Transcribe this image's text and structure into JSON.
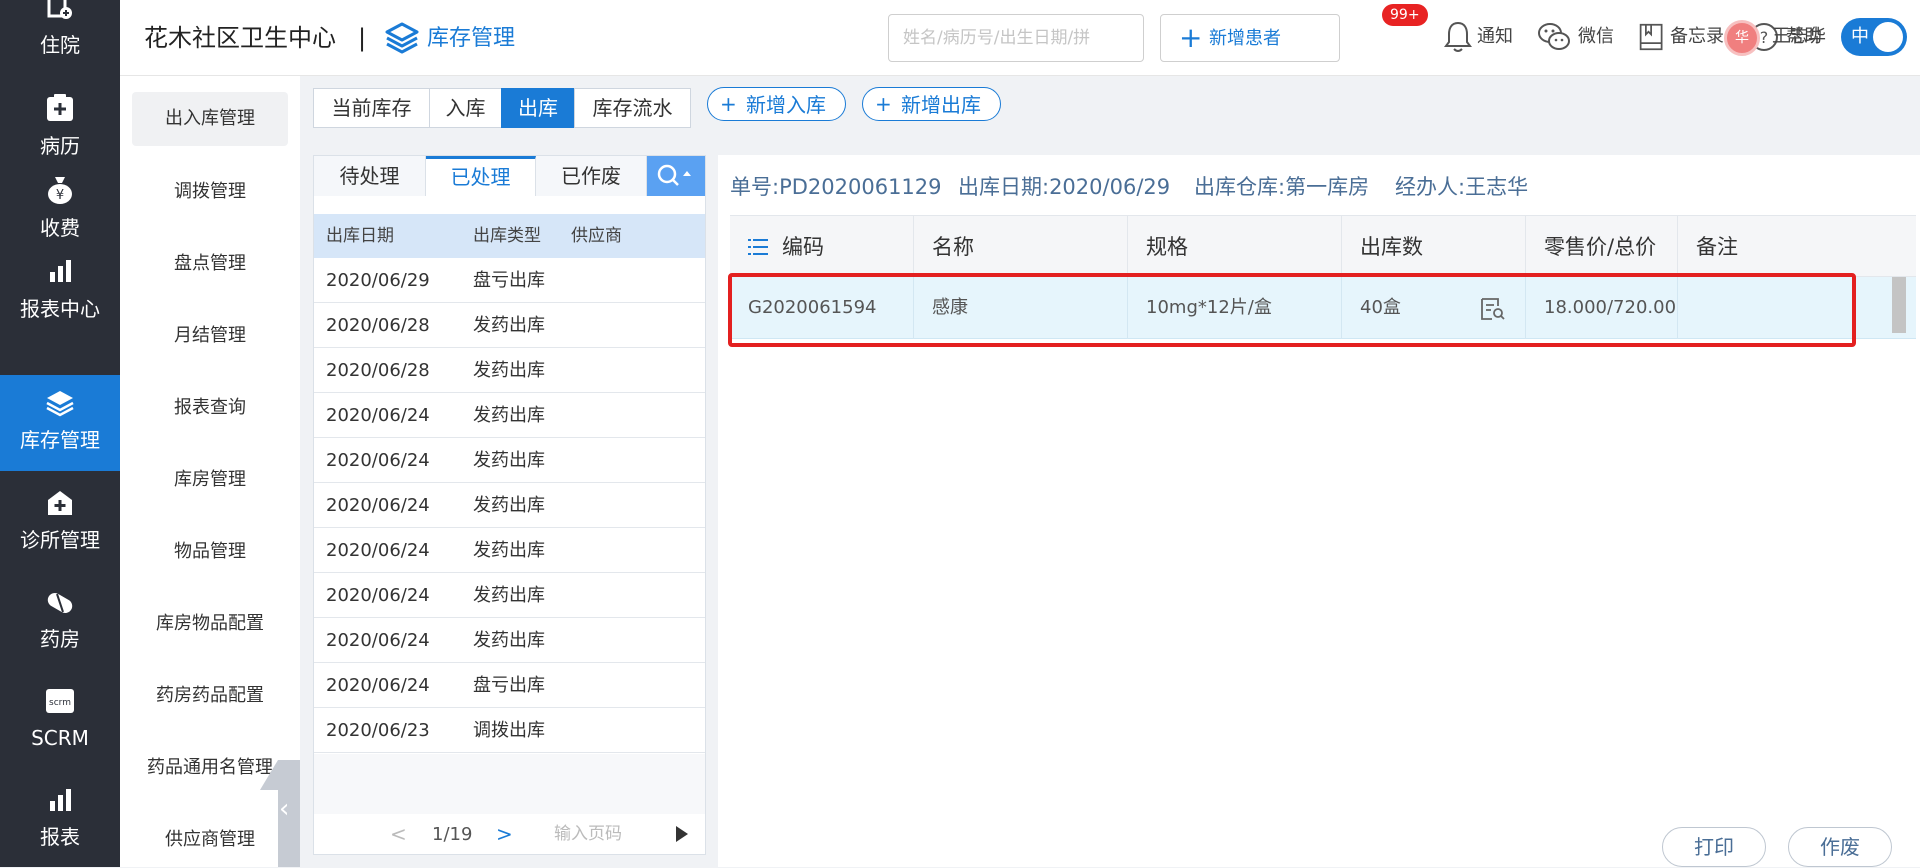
{
  "app": {
    "org_name": "花木社区卫生中心",
    "separator": "|",
    "module_title": "库存管理"
  },
  "colors": {
    "primary": "#1a7bd6",
    "nav_bg": "#2b2f38",
    "highlight": "#e32020",
    "badge": "#e82323"
  },
  "leftnav": [
    {
      "label": "住院",
      "icon": "hospital-bed-icon"
    },
    {
      "label": "病历",
      "icon": "medical-record-icon"
    },
    {
      "label": "收费",
      "icon": "money-bag-icon"
    },
    {
      "label": "报表中心",
      "icon": "bar-chart-icon"
    },
    {
      "label": "库存管理",
      "icon": "layers-icon",
      "active": true
    },
    {
      "label": "诊所管理",
      "icon": "clinic-icon"
    },
    {
      "label": "药房",
      "icon": "pill-icon"
    },
    {
      "label": "SCRM",
      "icon": "scrm-icon"
    },
    {
      "label": "报表",
      "icon": "bar-chart-icon"
    }
  ],
  "topbar": {
    "search_placeholder": "姓名/病历号/出生日期/拼",
    "add_patient_label": "新增患者",
    "notify_label": "通知",
    "notify_badge": "99+",
    "wechat_label": "微信",
    "memo_label": "备忘录",
    "help_label": "帮助",
    "avatar_text": "华",
    "user_name": "王志华",
    "toggle_label": "中"
  },
  "submenu": [
    {
      "label": "出入库管理",
      "active": true
    },
    {
      "label": "调拨管理"
    },
    {
      "label": "盘点管理"
    },
    {
      "label": "月结管理"
    },
    {
      "label": "报表查询"
    },
    {
      "label": "库房管理"
    },
    {
      "label": "物品管理"
    },
    {
      "label": "库房物品配置"
    },
    {
      "label": "药房药品配置"
    },
    {
      "label": "药品通用名管理"
    },
    {
      "label": "供应商管理"
    }
  ],
  "main_tabs": [
    {
      "label": "当前库存"
    },
    {
      "label": "入库"
    },
    {
      "label": "出库",
      "active": true
    },
    {
      "label": "库存流水"
    }
  ],
  "actions": {
    "new_in": "新增入库",
    "new_out": "新增出库",
    "plus": "+"
  },
  "list": {
    "tabs": [
      {
        "label": "待处理"
      },
      {
        "label": "已处理",
        "active": true
      },
      {
        "label": "已作废"
      }
    ],
    "columns": [
      "出库日期",
      "出库类型",
      "供应商"
    ],
    "rows": [
      {
        "date": "2020/06/29",
        "type": "盘亏出库"
      },
      {
        "date": "2020/06/28",
        "type": "发药出库"
      },
      {
        "date": "2020/06/28",
        "type": "发药出库"
      },
      {
        "date": "2020/06/24",
        "type": "发药出库"
      },
      {
        "date": "2020/06/24",
        "type": "发药出库"
      },
      {
        "date": "2020/06/24",
        "type": "发药出库"
      },
      {
        "date": "2020/06/24",
        "type": "发药出库"
      },
      {
        "date": "2020/06/24",
        "type": "发药出库"
      },
      {
        "date": "2020/06/24",
        "type": "发药出库"
      },
      {
        "date": "2020/06/24",
        "type": "盘亏出库"
      },
      {
        "date": "2020/06/23",
        "type": "调拨出库"
      }
    ],
    "pager": {
      "page": "1/19",
      "goto_placeholder": "输入页码",
      "prev": "<",
      "next": ">"
    }
  },
  "detail": {
    "doc_no": "单号:PD2020061129",
    "out_date": "出库日期:2020/06/29",
    "warehouse": "出库仓库:第一库房",
    "handler": "经办人:王志华",
    "columns": [
      "编码",
      "名称",
      "规格",
      "出库数",
      "零售价/总价",
      "备注"
    ],
    "row": {
      "code": "G2020061594",
      "name": "感康",
      "spec": "10mg*12片/盒",
      "qty": "40盒",
      "price": "18.000/720.00",
      "note": ""
    },
    "print_label": "打印",
    "void_label": "作废"
  }
}
